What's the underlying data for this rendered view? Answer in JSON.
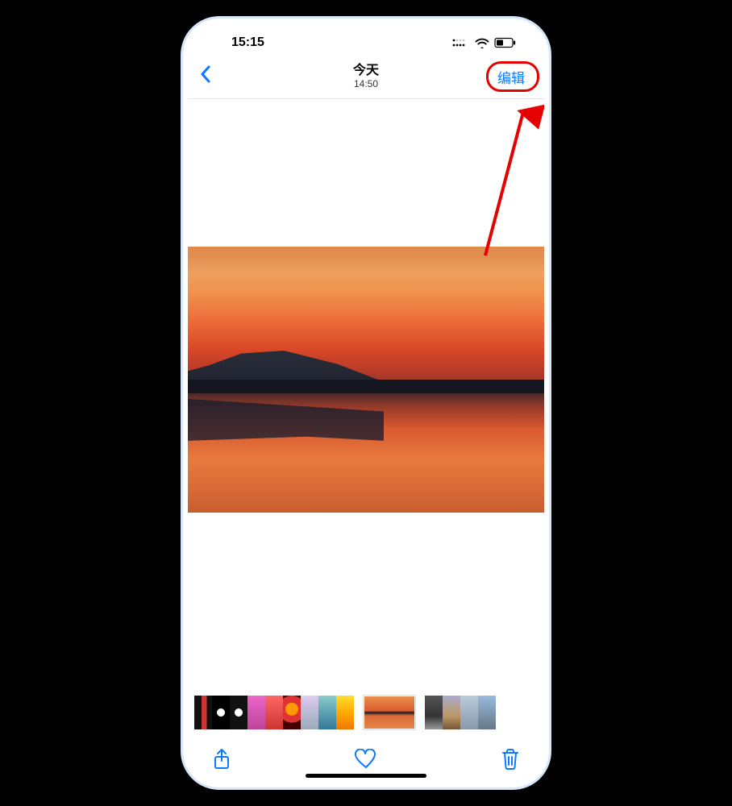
{
  "status_bar": {
    "time": "15:15",
    "icons": {
      "signal": "dual-sim-signal-icon",
      "wifi": "wifi-icon",
      "battery": "battery-icon",
      "battery_level": "40"
    }
  },
  "nav": {
    "back_icon": "chevron-left-icon",
    "title": "今天",
    "subtitle": "14:50",
    "edit_label": "编辑"
  },
  "annotation": {
    "highlight_target": "edit-button",
    "arrow_color": "#e60000"
  },
  "main_photo": {
    "description": "sunset-landscape"
  },
  "thumbnails": [
    {
      "id": "t1",
      "style": "linear-gradient(90deg,#111 40%,#c33 40%,#c33 70%,#111 70%)"
    },
    {
      "id": "t2",
      "style": "radial-gradient(circle at 50% 50%,#fff 0 20%,#000 22%)"
    },
    {
      "id": "t3",
      "style": "radial-gradient(circle at 50% 50%,#fff 0 20%,#111 22%)"
    },
    {
      "id": "t4",
      "style": "linear-gradient(180deg,#e6c 0%,#b49 100%)"
    },
    {
      "id": "t5",
      "style": "linear-gradient(180deg,#f66 0%,#c33 100%)"
    },
    {
      "id": "t6",
      "style": "radial-gradient(circle at 50% 40%,#f90 0 28%,#d33 30% 60%,#400 62%)"
    },
    {
      "id": "t7",
      "style": "linear-gradient(180deg,#dce 0%,#9ab 100%)"
    },
    {
      "id": "t8",
      "style": "linear-gradient(180deg,#8cc 0%,#379 100%)"
    },
    {
      "id": "t9",
      "style": "linear-gradient(180deg,#fd3 0%,#fa0 50%,#e70 100%)"
    },
    {
      "id": "current",
      "style": "main",
      "current": true
    },
    {
      "id": "t10",
      "style": "linear-gradient(180deg,#555 0%,#333 60%,#999 100%)"
    },
    {
      "id": "t11",
      "style": "linear-gradient(180deg,#aac 0%,#b96 60%,#753 100%)"
    },
    {
      "id": "t12",
      "style": "linear-gradient(180deg,#bcd 0%,#89a 100%)"
    },
    {
      "id": "t13",
      "style": "linear-gradient(180deg,#9bd 0%,#678 100%)"
    }
  ],
  "toolbar": {
    "share_icon": "share-icon",
    "favorite_icon": "heart-icon",
    "delete_icon": "trash-icon"
  }
}
